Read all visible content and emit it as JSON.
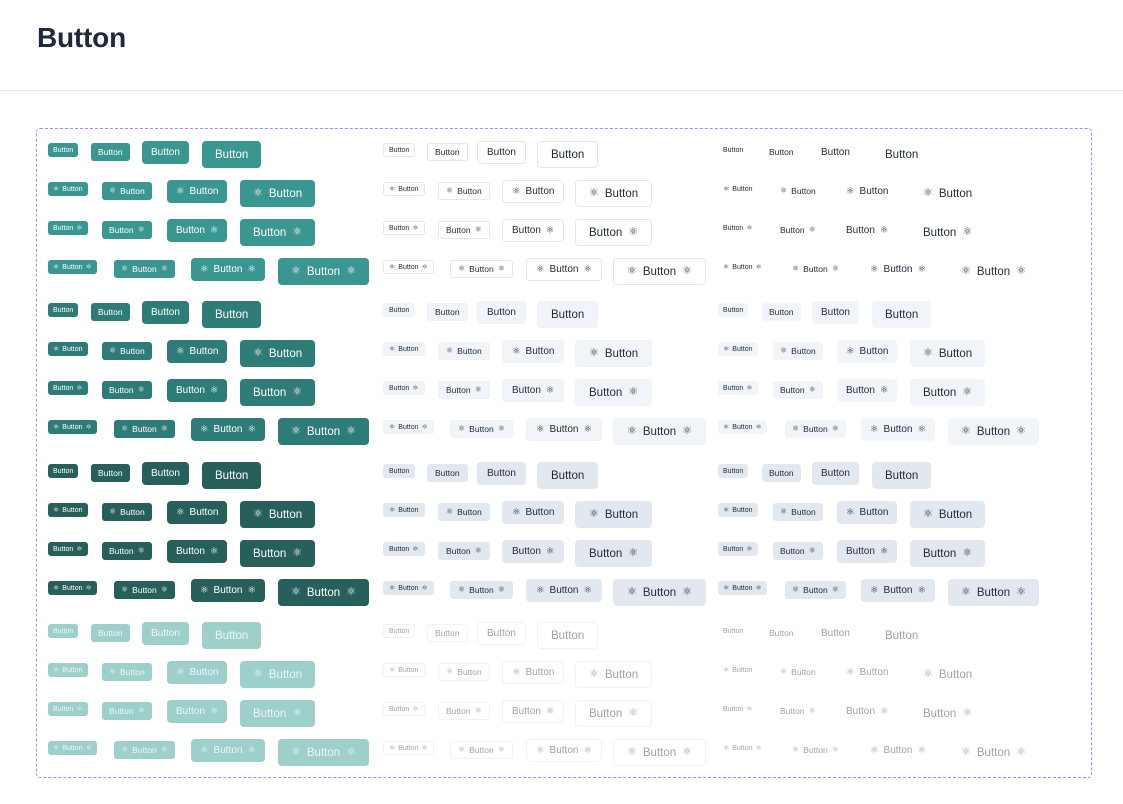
{
  "page": {
    "title": "Button"
  },
  "button": {
    "label": "Button",
    "icon": "atom-icon",
    "icon_glyph": "⚛"
  },
  "colors": {
    "primary_default": "#3a9690",
    "primary_hover": "#2e7c77",
    "primary_active": "#275f5b",
    "primary_disabled": "#9dcfcb",
    "frame_border": "#a78bfa"
  },
  "variants": [
    "primary",
    "outline",
    "ghost"
  ],
  "states": [
    "default",
    "hover",
    "active",
    "disabled"
  ],
  "icon_layouts": [
    "none",
    "leading",
    "trailing",
    "both"
  ],
  "sizes": [
    "xs",
    "sm",
    "md",
    "lg"
  ]
}
